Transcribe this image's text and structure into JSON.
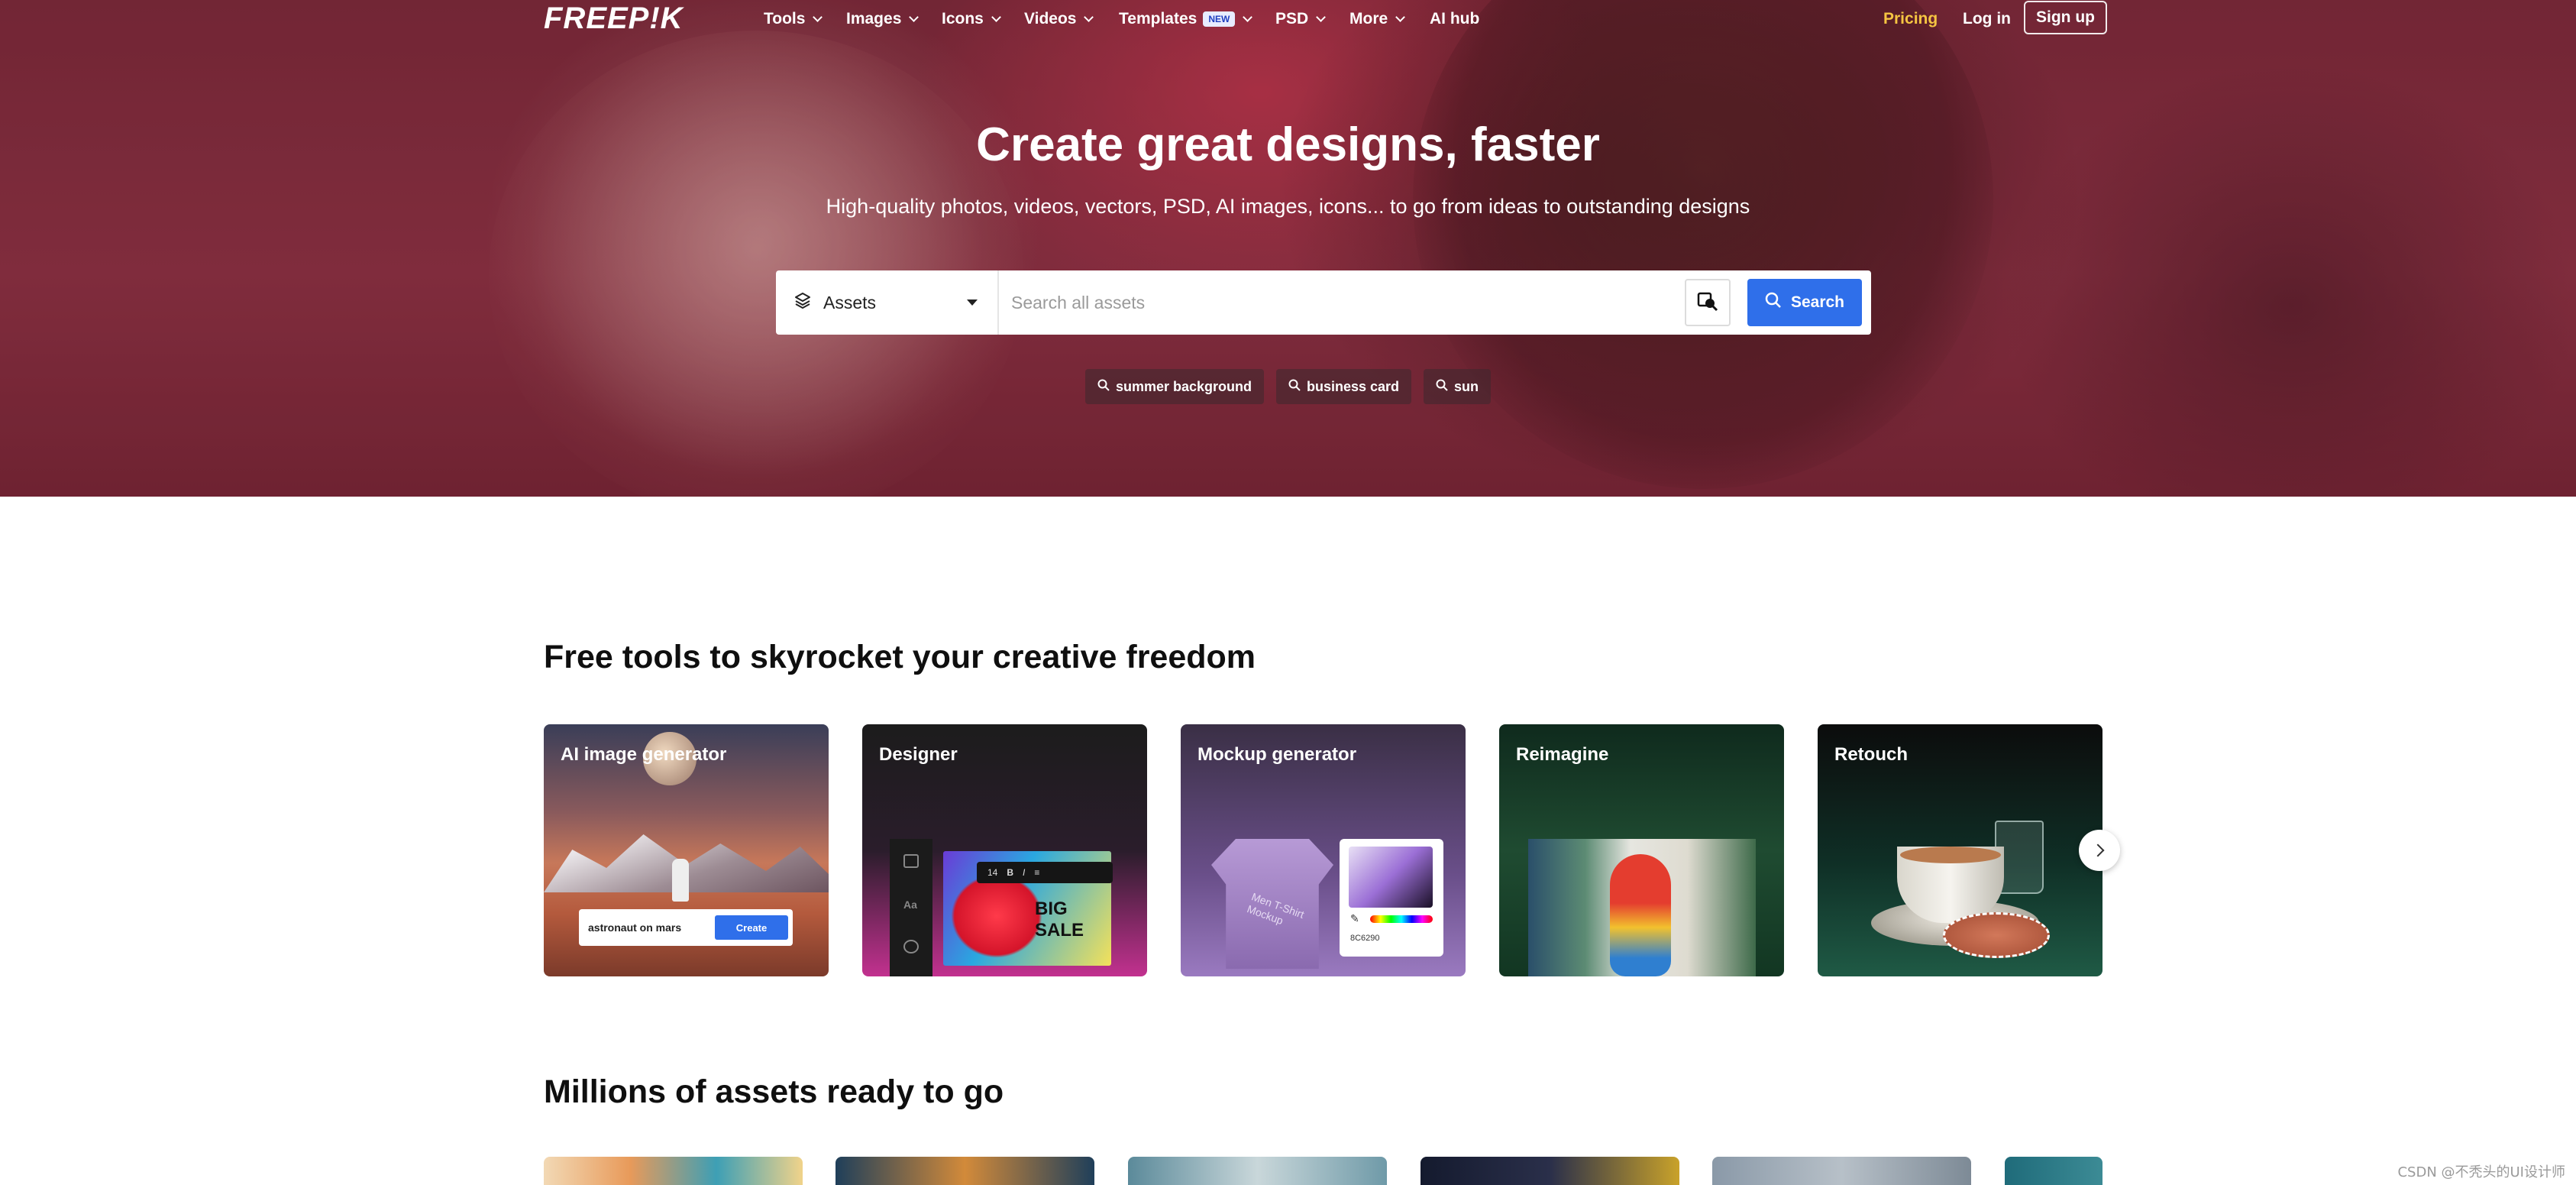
{
  "nav": {
    "logo": "FREEP!K",
    "items": [
      {
        "label": "Tools"
      },
      {
        "label": "Images"
      },
      {
        "label": "Icons"
      },
      {
        "label": "Videos"
      },
      {
        "label": "Templates",
        "badge": "NEW"
      },
      {
        "label": "PSD"
      },
      {
        "label": "More"
      },
      {
        "label": "AI hub"
      }
    ],
    "pricing": "Pricing",
    "login": "Log in",
    "signup": "Sign up"
  },
  "hero": {
    "title": "Create great designs, faster",
    "subtitle": "High-quality photos, videos, vectors, PSD, AI images, icons... to go from ideas to outstanding designs"
  },
  "search": {
    "asset_type": "Assets",
    "placeholder": "Search all assets",
    "button": "Search",
    "suggestions": [
      "summer background",
      "business card",
      "sun"
    ]
  },
  "tools_section": {
    "title": "Free tools to skyrocket your creative freedom",
    "cards": [
      {
        "title": "AI image generator",
        "prompt": "astronaut on mars",
        "action": "Create"
      },
      {
        "title": "Designer",
        "toolbar_size": "14",
        "promo": "BIG SALE"
      },
      {
        "title": "Mockup generator",
        "shirt_text": "Men T-Shirt Mockup",
        "hex": "8C6290"
      },
      {
        "title": "Reimagine"
      },
      {
        "title": "Retouch"
      }
    ]
  },
  "assets_section": {
    "title": "Millions of assets ready to go"
  },
  "watermark": "CSDN @不秃头的UI设计师",
  "colors": {
    "accent": "#2f6fea",
    "pricing": "#f5c542",
    "hero_bg": "#8f3446"
  }
}
